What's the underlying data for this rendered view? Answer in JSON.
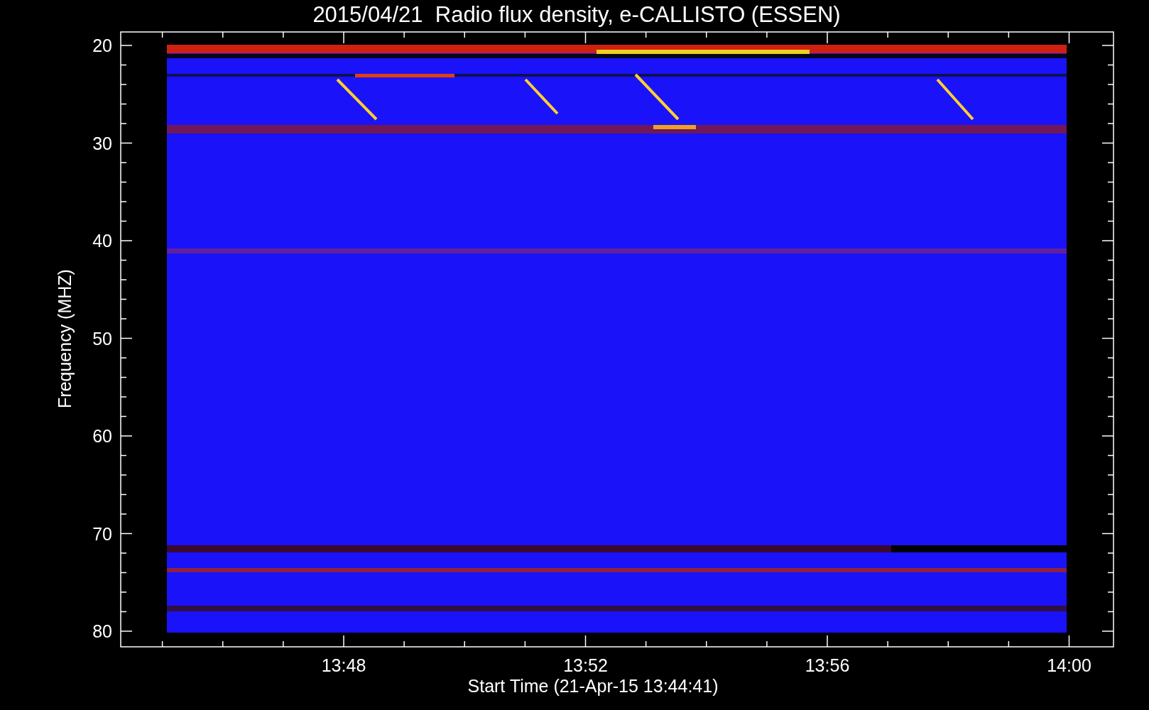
{
  "title": "2015/04/21  Radio flux density, e-CALLISTO (ESSEN)",
  "y_axis": {
    "label": "Frequency (MHZ)",
    "ticks": [
      "20",
      "30",
      "40",
      "50",
      "60",
      "70",
      "80"
    ]
  },
  "x_axis": {
    "label": "Start Time (21-Apr-15 13:44:41)",
    "ticks": [
      "13:48",
      "13:52",
      "13:56",
      "14:00"
    ]
  }
}
